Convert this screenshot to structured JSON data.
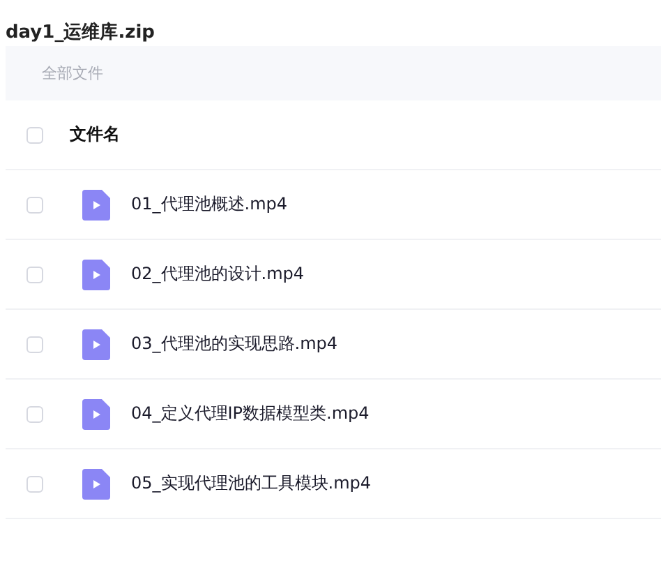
{
  "title": "day1_运维库.zip",
  "breadcrumb": "全部文件",
  "header": {
    "label": "文件名",
    "checked": false
  },
  "files": [
    {
      "name": "01_代理池概述.mp4",
      "checked": false
    },
    {
      "name": "02_代理池的设计.mp4",
      "checked": false
    },
    {
      "name": "03_代理池的实现思路.mp4",
      "checked": false
    },
    {
      "name": "04_定义代理IP数据模型类.mp4",
      "checked": false
    },
    {
      "name": "05_实现代理池的工具模块.mp4",
      "checked": false
    }
  ]
}
